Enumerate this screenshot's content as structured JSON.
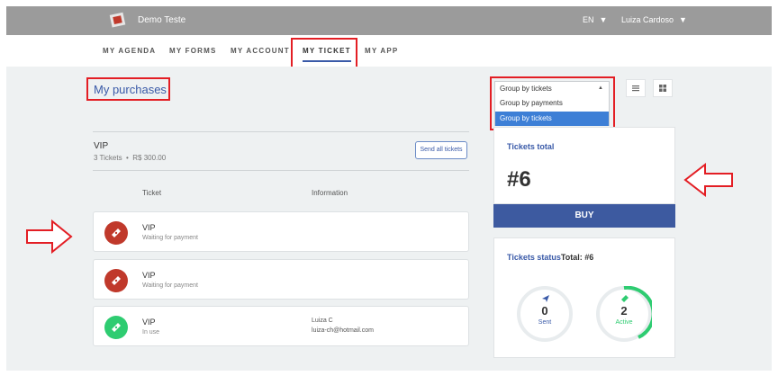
{
  "app": {
    "name": "Demo Teste"
  },
  "header": {
    "language": "EN",
    "user": "Luiza Cardoso"
  },
  "nav": [
    {
      "label": "MY AGENDA"
    },
    {
      "label": "MY FORMS"
    },
    {
      "label": "MY ACCOUNT"
    },
    {
      "label": "MY TICKET"
    },
    {
      "label": "MY APP"
    }
  ],
  "page": {
    "title": "My purchases"
  },
  "group": {
    "name": "VIP",
    "tickets": "3 Tickets",
    "amount": "R$ 300.00",
    "send_all_label": "Send all tickets"
  },
  "columns": {
    "ticket": "Ticket",
    "information": "Information"
  },
  "tickets": [
    {
      "name": "VIP",
      "status": "Waiting for payment",
      "info_name": "",
      "info_email": "",
      "icon": "ticket-icon",
      "color": "#c0392b"
    },
    {
      "name": "VIP",
      "status": "Waiting for payment",
      "info_name": "",
      "info_email": "",
      "icon": "ticket-icon",
      "color": "#c0392b"
    },
    {
      "name": "VIP",
      "status": "In use",
      "info_name": "Luiza C",
      "info_email": "luiza-ch@hotmail.com",
      "icon": "ticket-icon",
      "color": "#2ecc71"
    }
  ],
  "group_by": {
    "selected": "Group by tickets",
    "options": [
      "Group by payments",
      "Group by tickets"
    ]
  },
  "summary": {
    "total_label": "Tickets total",
    "total_value": "#6",
    "buy_label": "BUY",
    "status_label": "Tickets status",
    "status_total": "Total: #6",
    "sent_value": "0",
    "sent_label": "Sent",
    "active_value": "2",
    "active_label": "Active"
  },
  "colors": {
    "accent": "#3a5aa8",
    "buy": "#3d5aa0",
    "highlight": "#e31e24",
    "active": "#2ecc71",
    "pending": "#c0392b"
  }
}
